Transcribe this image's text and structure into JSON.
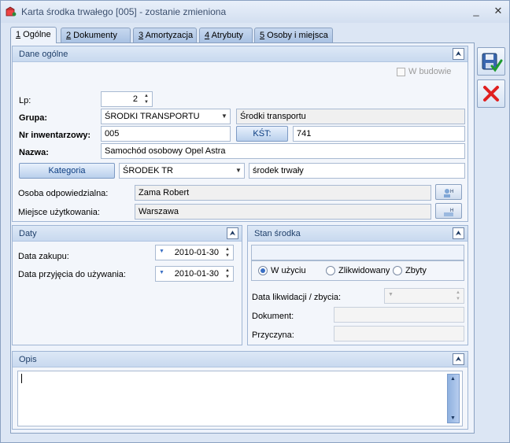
{
  "window": {
    "title": "Karta środka trwałego [005] - zostanie zmieniona",
    "min_icon": "minimize-icon",
    "close_icon": "close-icon"
  },
  "tabs": [
    {
      "key": "1",
      "label": " Ogólne"
    },
    {
      "key": "2",
      "label": " Dokumenty"
    },
    {
      "key": "3",
      "label": " Amortyzacja"
    },
    {
      "key": "4",
      "label": " Atrybuty"
    },
    {
      "key": "5",
      "label": " Osoby i miejsca"
    }
  ],
  "dane": {
    "header": "Dane ogólne",
    "w_budowie": "W budowie",
    "lp_label": "Lp:",
    "lp_value": "2",
    "grupa_label": "Grupa:",
    "grupa_value": "ŚRODKI TRANSPORTU",
    "grupa_desc": "Środki transportu",
    "nr_label": "Nr inwentarzowy:",
    "nr_value": "005",
    "kst_button": "KŚT:",
    "kst_value": "741",
    "nazwa_label": "Nazwa:",
    "nazwa_value": "Samochód osobowy Opel Astra",
    "kategoria_button": "Kategoria",
    "kategoria_value": "ŚRODEK TR",
    "kategoria_desc": "środek trwały",
    "osoba_label": "Osoba odpowiedzialna:",
    "osoba_value": "Zama Robert",
    "miejsce_label": "Miejsce użytkowania:",
    "miejsce_value": "Warszawa"
  },
  "daty": {
    "header": "Daty",
    "zakup_label": "Data zakupu:",
    "zakup_value": "2010-01-30",
    "przyjecie_label": "Data przyjęcia do używania:",
    "przyjecie_value": "2010-01-30"
  },
  "stan": {
    "header": "Stan środka",
    "options": [
      "W użyciu",
      "Zlikwidowany",
      "Zbyty"
    ],
    "selected": "W użyciu",
    "likwidacja_label": "Data likwidacji / zbycia:",
    "dokument_label": "Dokument:",
    "przyczyna_label": "Przyczyna:"
  },
  "opis": {
    "header": "Opis",
    "value": ""
  },
  "side": {
    "save_icon": "save-icon",
    "cancel_icon": "cancel-icon"
  }
}
